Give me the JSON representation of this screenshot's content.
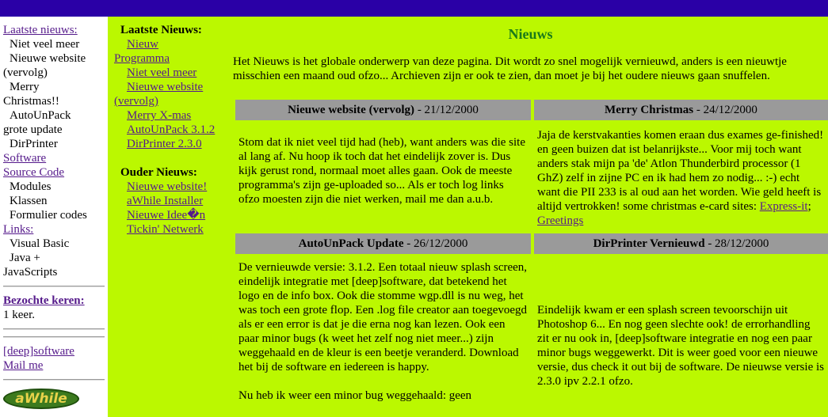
{
  "leftnav": {
    "items": [
      {
        "text": "Laatste nieuws:",
        "link": true,
        "indent": false,
        "bold": false
      },
      {
        "text": "Niet veel meer",
        "link": false,
        "indent": true,
        "bold": false
      },
      {
        "text": "Nieuwe website",
        "link": false,
        "indent": true,
        "bold": false
      },
      {
        "text": "(vervolg)",
        "link": false,
        "indent": false,
        "bold": false
      },
      {
        "text": "Merry",
        "link": false,
        "indent": true,
        "bold": false
      },
      {
        "text": "Christmas!!",
        "link": false,
        "indent": false,
        "bold": false
      },
      {
        "text": "AutoUnPack",
        "link": false,
        "indent": true,
        "bold": false
      },
      {
        "text": "grote update",
        "link": false,
        "indent": false,
        "bold": false
      },
      {
        "text": "DirPrinter",
        "link": false,
        "indent": true,
        "bold": false
      },
      {
        "text": "Software",
        "link": true,
        "indent": false,
        "bold": false
      },
      {
        "text": "Source Code",
        "link": true,
        "indent": false,
        "bold": false
      },
      {
        "text": "Modules",
        "link": false,
        "indent": true,
        "bold": false
      },
      {
        "text": "Klassen",
        "link": false,
        "indent": true,
        "bold": false
      },
      {
        "text": "Formulier codes",
        "link": false,
        "indent": true,
        "bold": false
      },
      {
        "text": "Links:",
        "link": true,
        "indent": false,
        "bold": false
      },
      {
        "text": "Visual Basic",
        "link": false,
        "indent": true,
        "bold": false
      },
      {
        "text": "Java +",
        "link": false,
        "indent": true,
        "bold": false
      },
      {
        "text": "JavaScripts",
        "link": false,
        "indent": false,
        "bold": false
      }
    ],
    "visits_label": "Bezochte keren:",
    "visits_value": "1 keer.",
    "deep_link": "[deep]software",
    "mail_link": "Mail me",
    "logo_text": "aWhile"
  },
  "subnav": {
    "latest_heading": "Laatste Nieuws:",
    "latest": [
      {
        "text": "Nieuw Programma",
        "wrap": true
      },
      {
        "text": "Niet veel meer",
        "wrap": false
      },
      {
        "text": "Nieuwe website (vervolg)",
        "wrap": true
      },
      {
        "text": "Merry X-mas",
        "wrap": false
      },
      {
        "text": "AutoUnPack 3.1.2",
        "wrap": true
      },
      {
        "text": "DirPrinter 2.3.0",
        "wrap": false
      }
    ],
    "older_heading": "Ouder Nieuws:",
    "older": [
      {
        "text": "Nieuwe website!"
      },
      {
        "text": "aWhile Installer"
      },
      {
        "text": "Nieuwe Idee�n"
      },
      {
        "text": "Tickin' Netwerk"
      }
    ]
  },
  "content": {
    "title": "Nieuws",
    "intro": "Het Nieuws is het globale onderwerp van deze pagina. Dit wordt zo snel mogelijk vernieuwd, anders is een nieuwtje misschien een maand oud ofzo... Archieven zijn er ook te zien, dan moet je bij het oudere nieuws gaan snuffelen."
  },
  "cards": [
    {
      "title": "Nieuwe website (vervolg)",
      "date": " - 21/12/2000",
      "body": [
        "Stom dat ik niet veel tijd had (heb), want anders was die site al lang af. Nu hoop ik toch dat het eindelijk zover is. Dus kijk gerust rond, normaal moet alles gaan. Ook de meeste programma's zijn ge-uploaded so... Als er toch log links ofzo moesten zijn die niet werken, mail me dan a.u.b."
      ]
    },
    {
      "title": "Merry Christmas",
      "date": " - 24/12/2000",
      "body": [
        "Jaja de kerstvakanties komen eraan dus exames ge-finished! en geen buizen dat ist belanrijkste... Voor mij toch want anders stak mijn pa 'de' Atlon Thunderbird processor (1 GhZ) zelf in zijne PC en ik had hem zo nodig... :-) echt want die PII 233 is al oud aan het worden. Wie geld heeft is altijd vertrokken! some christmas e-card sites: "
      ],
      "links": [
        "Express-it",
        "Greetings"
      ]
    },
    {
      "title": "AutoUnPack Update",
      "date": " - 26/12/2000",
      "body": [
        "De vernieuwde versie: 3.1.2. Een totaal nieuw splash screen, eindelijk integratie met [deep]software, dat betekend het logo en de info box. Ook die stomme wgp.dll is nu weg, het was toch een grote flop. Een .log file creator aan toegevoegd als er een error is dat je die erna nog kan lezen. Ook een paar minor bugs (k weet het zelf nog niet meer...) zijn weggehaald en de kleur is een beetje veranderd. Download het bij de software en iedereen is happy.",
        "Nu heb ik weer een minor bug weggehaald: geen"
      ]
    },
    {
      "title": "DirPrinter Vernieuwd",
      "date": " - 28/12/2000",
      "body": [
        "Eindelijk kwam er een splash screen tevoorschijn uit Photoshop 6... En nog geen slechte ook! de errorhandling zit er nu ook in, [deep]software integratie en nog een paar minor bugs weggewerkt. Dit is weer goed voor een nieuwe versie, dus check it out bij de software. De nieuwse versie is 2.3.0 ipv 2.2.1 ofzo."
      ]
    }
  ]
}
